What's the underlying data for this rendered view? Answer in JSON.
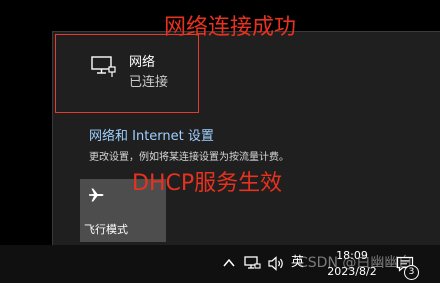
{
  "flyout": {
    "network": {
      "icon": "ethernet-monitor-icon",
      "name": "网络",
      "status": "已连接"
    },
    "settings_link": "网络和 Internet 设置",
    "settings_desc": "更改设置，例如将某连接设置为按流量计费。",
    "airplane": {
      "icon": "airplane-icon",
      "label": "飞行模式"
    }
  },
  "annotations": {
    "network_success": "网络连接成功",
    "dhcp_effective": "DHCP服务生效",
    "color": "#e8311f"
  },
  "taskbar": {
    "ime": "英",
    "time": "18:09",
    "date": "2023/8/2",
    "notification_count": "3",
    "watermark": "CSDN @白幽幽白"
  },
  "colors": {
    "flyout_bg": "#1f1f1f",
    "tile_bg": "#4d4d4d",
    "link": "#9fd0ff",
    "taskbar_bg": "#101010",
    "highlight_border": "#e33b2e"
  }
}
